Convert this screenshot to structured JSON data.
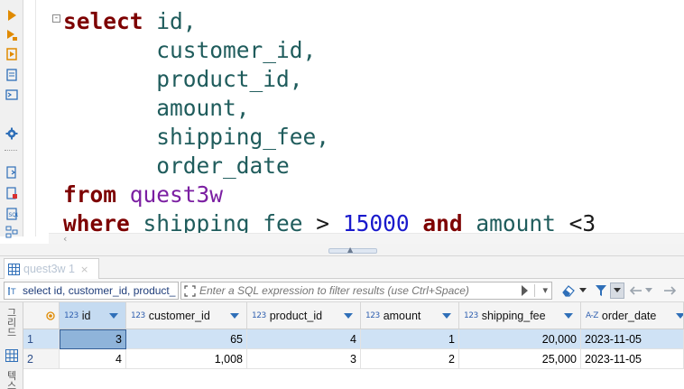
{
  "editor": {
    "lines": [
      [
        {
          "t": "select",
          "c": "kw"
        },
        {
          "t": " id,",
          "c": "ident"
        }
      ],
      [
        {
          "t": "       customer_id,",
          "c": "ident"
        }
      ],
      [
        {
          "t": "       product_id,",
          "c": "ident"
        }
      ],
      [
        {
          "t": "       amount,",
          "c": "ident"
        }
      ],
      [
        {
          "t": "       shipping_fee,",
          "c": "ident"
        }
      ],
      [
        {
          "t": "       order_date",
          "c": "ident"
        }
      ],
      [
        {
          "t": "from",
          "c": "kw"
        },
        {
          "t": " ",
          "c": "ident"
        },
        {
          "t": "quest3w",
          "c": "table-name"
        }
      ],
      [
        {
          "t": "where",
          "c": "kw"
        },
        {
          "t": " shipping_fee ",
          "c": "ident"
        },
        {
          "t": ">",
          "c": "op"
        },
        {
          "t": " ",
          "c": "ident"
        },
        {
          "t": "15000",
          "c": "num"
        },
        {
          "t": " ",
          "c": "ident"
        },
        {
          "t": "and",
          "c": "kw"
        },
        {
          "t": " amount ",
          "c": "ident"
        },
        {
          "t": "<3",
          "c": "op"
        }
      ]
    ],
    "fold_marker": "-"
  },
  "result_tab": {
    "label": "quest3w 1",
    "close": "×"
  },
  "filter_bar": {
    "query_text": "select id, customer_id, product_",
    "filter_placeholder": "Enter a SQL expression to filter results (use Ctrl+Space)",
    "history_dropdown": "▾"
  },
  "grid_side_labels": {
    "grid": "그리드",
    "text": "텍스트"
  },
  "grid": {
    "columns": [
      {
        "name": "id",
        "type": "123"
      },
      {
        "name": "customer_id",
        "type": "123"
      },
      {
        "name": "product_id",
        "type": "123"
      },
      {
        "name": "amount",
        "type": "123"
      },
      {
        "name": "shipping_fee",
        "type": "123"
      },
      {
        "name": "order_date",
        "type": "A-Z"
      }
    ],
    "rows": [
      {
        "num": "1",
        "cells": [
          "3",
          "65",
          "4",
          "1",
          "20,000",
          "2023-11-05"
        ]
      },
      {
        "num": "2",
        "cells": [
          "4",
          "1,008",
          "3",
          "2",
          "25,000",
          "2023-11-05"
        ]
      }
    ]
  },
  "colors": {
    "keyword": "#7d0000",
    "identifier": "#1f5c5c",
    "table": "#7b1fa2",
    "number": "#1a1acc",
    "selection": "#cfe2f5",
    "accent": "#2f6fb8"
  }
}
